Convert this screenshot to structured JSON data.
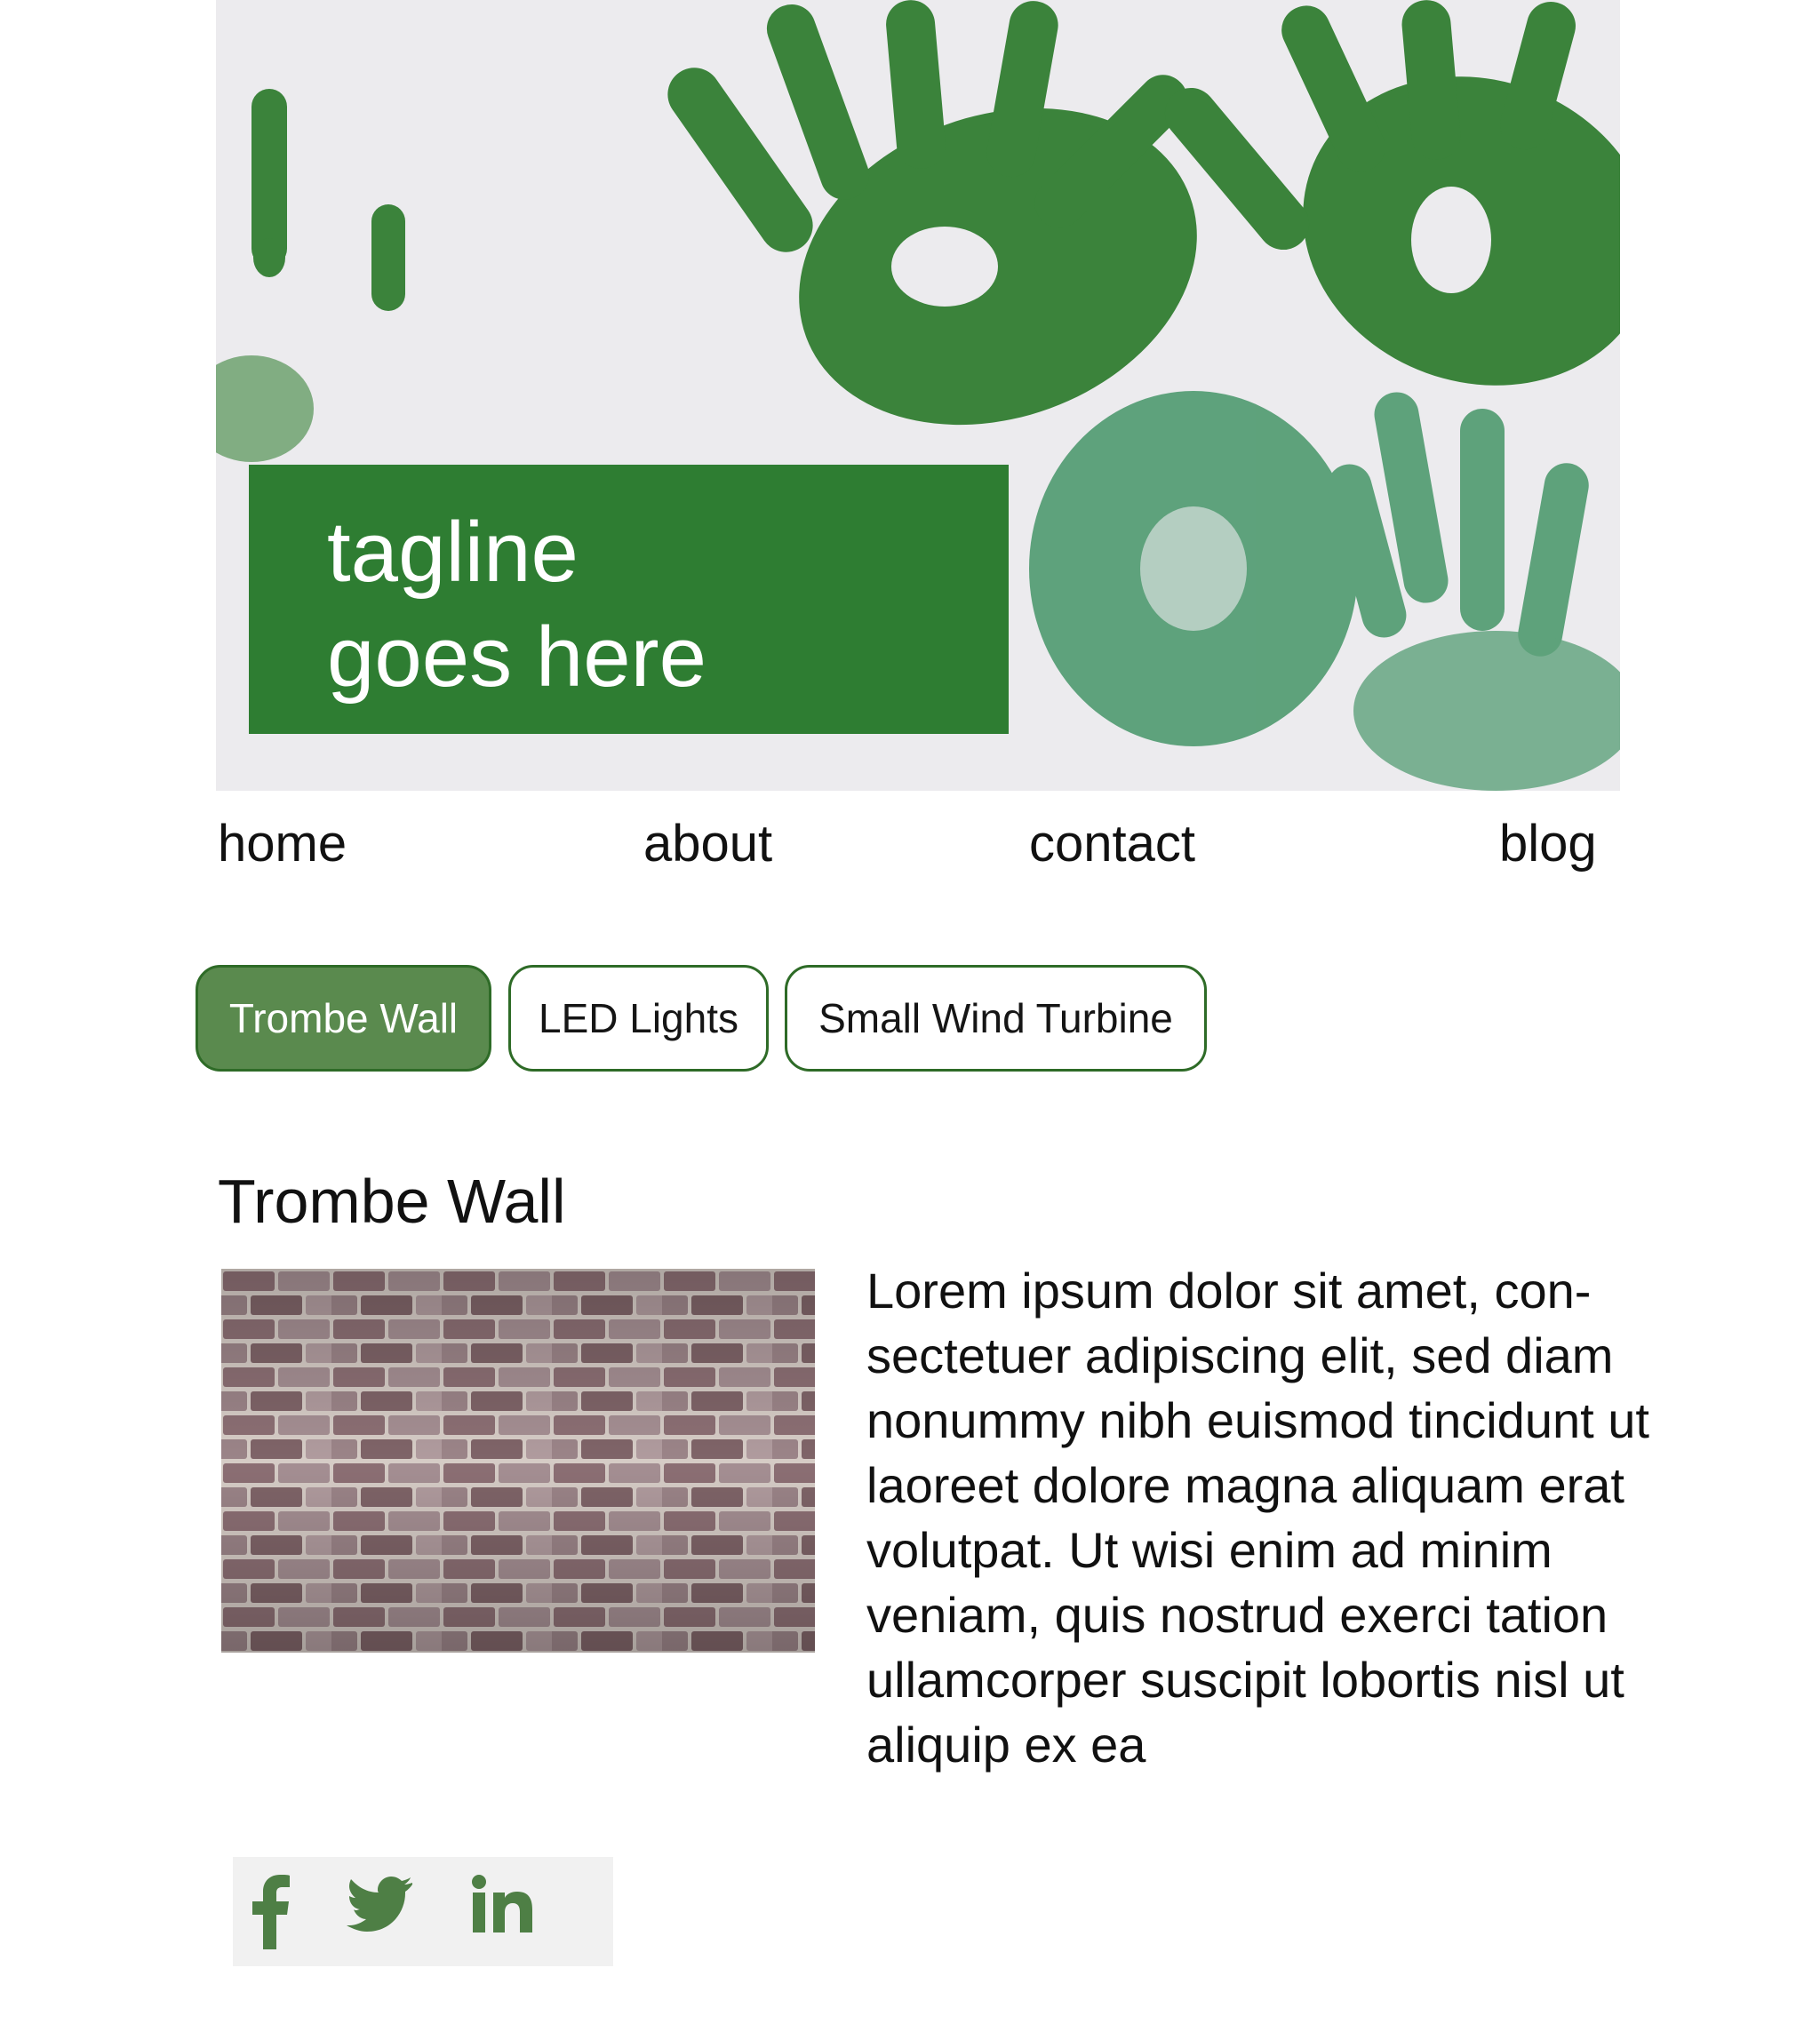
{
  "hero": {
    "tagline_line1": "tagline",
    "tagline_line2": "goes here",
    "image": "green-handprints",
    "brand_color": "#2e7d32"
  },
  "nav": {
    "items": [
      {
        "label": "home"
      },
      {
        "label": "about"
      },
      {
        "label": "contact"
      },
      {
        "label": "blog"
      }
    ]
  },
  "tabs": {
    "items": [
      {
        "label": "Trombe Wall",
        "active": true
      },
      {
        "label": "LED Lights",
        "active": false
      },
      {
        "label": "Small Wind Turbine",
        "active": false
      }
    ],
    "active_color": "#5a8a4e",
    "border_color": "#2e6b27"
  },
  "content": {
    "title": "Trombe Wall",
    "image": "brick-wall",
    "text": "Lorem ipsum dolor sit amet, con-sectetuer adipiscing elit, sed diam nonummy nibh euismod tincidunt ut laoreet dolore magna aliquam erat volutpat. Ut wisi enim ad minim veniam, quis nostrud exerci tation ullamcorper suscipit lobortis nisl ut aliquip ex ea"
  },
  "social": {
    "icons": [
      "facebook-icon",
      "twitter-icon",
      "linkedin-icon"
    ],
    "icon_color": "#4e7f45"
  }
}
